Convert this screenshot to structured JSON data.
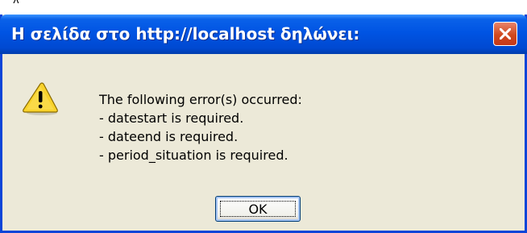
{
  "top_fragment": "λ",
  "dialog": {
    "title": "Η σελίδα στο http://localhost δηλώνει:",
    "icon": "warning-icon",
    "close_icon": "close-icon",
    "message_lines": [
      "The following error(s) occurred:",
      "- datestart is required.",
      "- dateend is required.",
      "- period_situation is required."
    ],
    "ok_label": "OK"
  },
  "colors": {
    "titlebar": "#0054e3",
    "dialog_bg": "#ece9d8",
    "close_button": "#d0491e",
    "warning_yellow": "#f8d22b"
  }
}
